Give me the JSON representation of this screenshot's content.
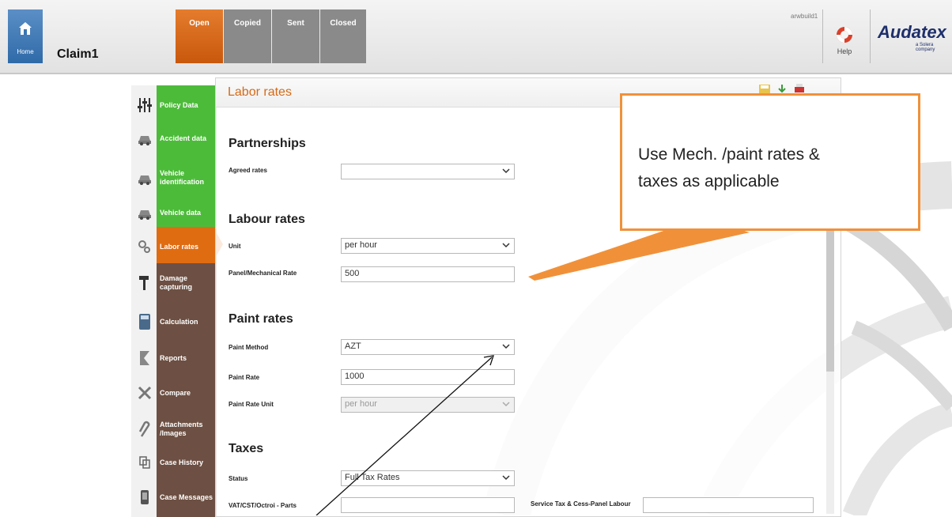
{
  "header": {
    "home_label": "Home",
    "claim_title": "Claim1",
    "status_tabs": [
      "Open",
      "Copied",
      "Sent",
      "Closed"
    ],
    "user": "arwbuild1",
    "help_label": "Help",
    "logo_text": "Audatex",
    "logo_sub": "a Solera company"
  },
  "sidebar": {
    "items": [
      {
        "label": "Policy Data",
        "icon": "sliders-icon",
        "state": "green"
      },
      {
        "label": "Accident data",
        "icon": "car-crash-icon",
        "state": "green"
      },
      {
        "label": "Vehicle identification",
        "icon": "car-icon",
        "state": "green"
      },
      {
        "label": "Vehicle data",
        "icon": "car-front-icon",
        "state": "green"
      },
      {
        "label": "Labor rates",
        "icon": "gears-icon",
        "state": "active"
      },
      {
        "label": "Damage capturing",
        "icon": "hammer-icon",
        "state": "brown"
      },
      {
        "label": "Calculation",
        "icon": "calculator-icon",
        "state": "brown"
      },
      {
        "label": "Reports",
        "icon": "report-icon",
        "state": "brown"
      },
      {
        "label": "Compare",
        "icon": "compare-icon",
        "state": "brown"
      },
      {
        "label": "Attachments /Images",
        "icon": "paperclip-icon",
        "state": "brown"
      },
      {
        "label": "Case History",
        "icon": "history-icon",
        "state": "brown"
      },
      {
        "label": "Case Messages",
        "icon": "phone-icon",
        "state": "brown"
      }
    ]
  },
  "panel": {
    "title": "Labor rates",
    "sections": {
      "partnerships": "Partnerships",
      "labour_rates": "Labour rates",
      "paint_rates": "Paint rates",
      "taxes": "Taxes"
    },
    "fields": {
      "agreed_rates": {
        "label": "Agreed rates",
        "value": ""
      },
      "unit": {
        "label": "Unit",
        "value": "per hour"
      },
      "panel_mech_rate": {
        "label": "Panel/Mechanical Rate",
        "value": "500"
      },
      "paint_method": {
        "label": "Paint Method",
        "value": "AZT"
      },
      "paint_rate": {
        "label": "Paint Rate",
        "value": "1000"
      },
      "paint_rate_unit": {
        "label": "Paint Rate Unit",
        "value": "per hour"
      },
      "status": {
        "label": "Status",
        "value": "Full Tax Rates"
      },
      "vat_parts": {
        "label": "VAT/CST/Octroi - Parts",
        "value": ""
      },
      "service_tax": {
        "label": "Service Tax & Cess-Panel Labour",
        "value": ""
      }
    }
  },
  "callout": {
    "text_line1": "Use Mech. /paint rates &",
    "text_line2": "taxes as applicable"
  },
  "colors": {
    "accent_orange": "#e06c12",
    "nav_green": "#4dbb3a",
    "nav_brown": "#6d5043",
    "callout_border": "#f0913a"
  }
}
